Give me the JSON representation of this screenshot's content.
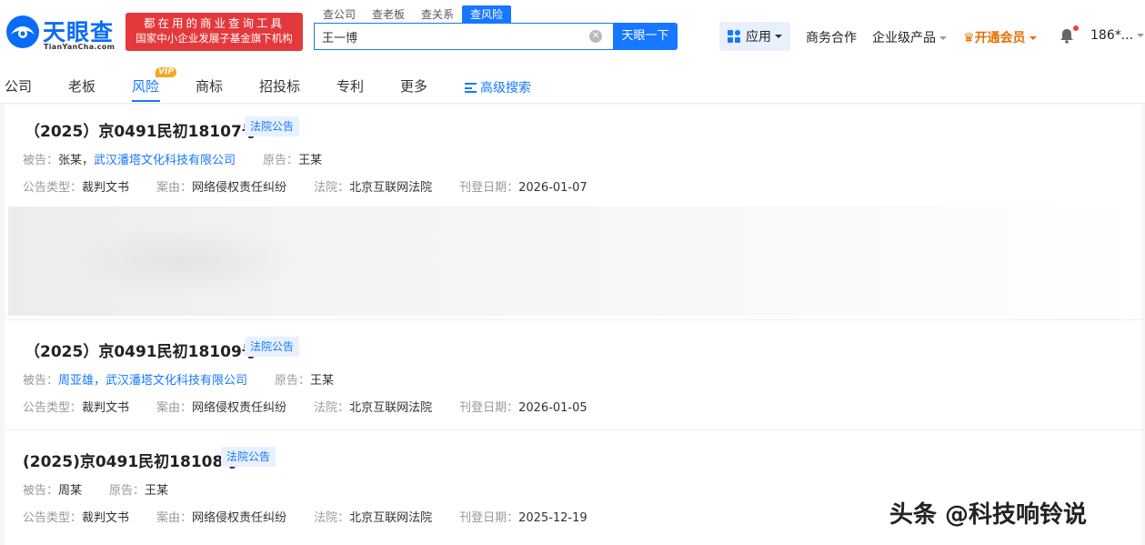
{
  "brand": {
    "name": "天眼查",
    "domain": "TianYanCha.com",
    "accent": "#1677ff"
  },
  "slogan": {
    "line1": "都在用的商业查询工具",
    "line2": "国家中小企业发展子基金旗下机构"
  },
  "search_tabs": [
    "查公司",
    "查老板",
    "查关系",
    "查风险"
  ],
  "search": {
    "value": "王一博",
    "button": "天眼一下"
  },
  "header_links": {
    "apps": "应用",
    "biz": "商务合作",
    "enterprise": "企业级产品",
    "vip": "开通会员",
    "user": "186*..."
  },
  "nav": {
    "items": [
      "公司",
      "老板",
      "风险",
      "商标",
      "招投标",
      "专利",
      "更多"
    ],
    "vip_badge": "VIP",
    "advanced": "高级搜索"
  },
  "labels": {
    "defendant": "被告：",
    "plaintiff": "原告：",
    "type": "公告类型：",
    "cause": "案由：",
    "court": "法院：",
    "date": "刊登日期："
  },
  "cases": [
    {
      "title": "（2025）京0491民初18107号",
      "tag": "法院公告",
      "defendant_plain": "张某，",
      "defendant_link": "武汉潘塔文化科技有限公司",
      "plaintiff": "王某",
      "type": "裁判文书",
      "cause": "网络侵权责任纠纷",
      "court": "北京互联网法院",
      "date": "2026-01-07"
    },
    {
      "title": "（2025）京0491民初18109号",
      "tag": "法院公告",
      "defendant_plain": "",
      "defendant_link": "周亚雄，武汉潘塔文化科技有限公司",
      "plaintiff": "王某",
      "type": "裁判文书",
      "cause": "网络侵权责任纠纷",
      "court": "北京互联网法院",
      "date": "2026-01-05"
    },
    {
      "title": "(2025)京0491民初18108号",
      "tag": "法院公告",
      "defendant_plain": "周某",
      "defendant_link": "",
      "plaintiff": "王某",
      "type": "裁判文书",
      "cause": "网络侵权责任纠纷",
      "court": "北京互联网法院",
      "date": "2025-12-19"
    }
  ],
  "watermark": "头条 @科技响铃说"
}
